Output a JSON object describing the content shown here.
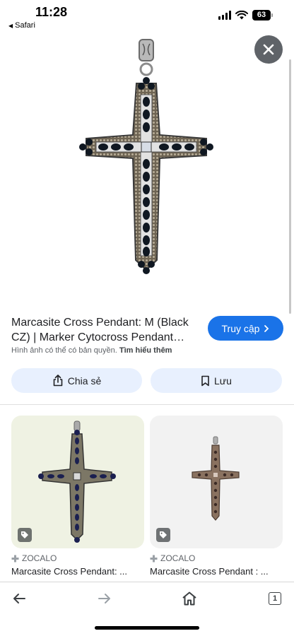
{
  "status_bar": {
    "time": "11:28",
    "back_app": "Safari",
    "battery": "63"
  },
  "product": {
    "title": "Marcasite Cross Pendant: M (Black CZ) | Marker Cytocross Pendant…",
    "visit_label": "Truy cập",
    "copyright_text": "Hình ảnh có thể có bản quyền.",
    "learn_more": "Tìm hiểu thêm"
  },
  "actions": {
    "share_label": "Chia sẻ",
    "save_label": "Lưu"
  },
  "related": [
    {
      "source": "ZOCALO",
      "title": "Marcasite Cross Pendant: ..."
    },
    {
      "source": "ZOCALO",
      "title": "Marcasite Cross Pendant : ..."
    }
  ],
  "toolbar": {
    "tab_count": "1"
  },
  "icons": {
    "close": "close-icon",
    "share": "share-icon",
    "save": "bookmark-icon",
    "visit": "chevron-right-icon",
    "back": "arrow-left-icon",
    "forward": "arrow-right-icon",
    "home": "home-icon",
    "tabs": "tabs-icon",
    "source": "source-icon",
    "badge": "tag-icon"
  },
  "colors": {
    "accent": "#1a73e8",
    "chip_bg": "#e8f0fe",
    "close_bg": "#5f6368"
  }
}
